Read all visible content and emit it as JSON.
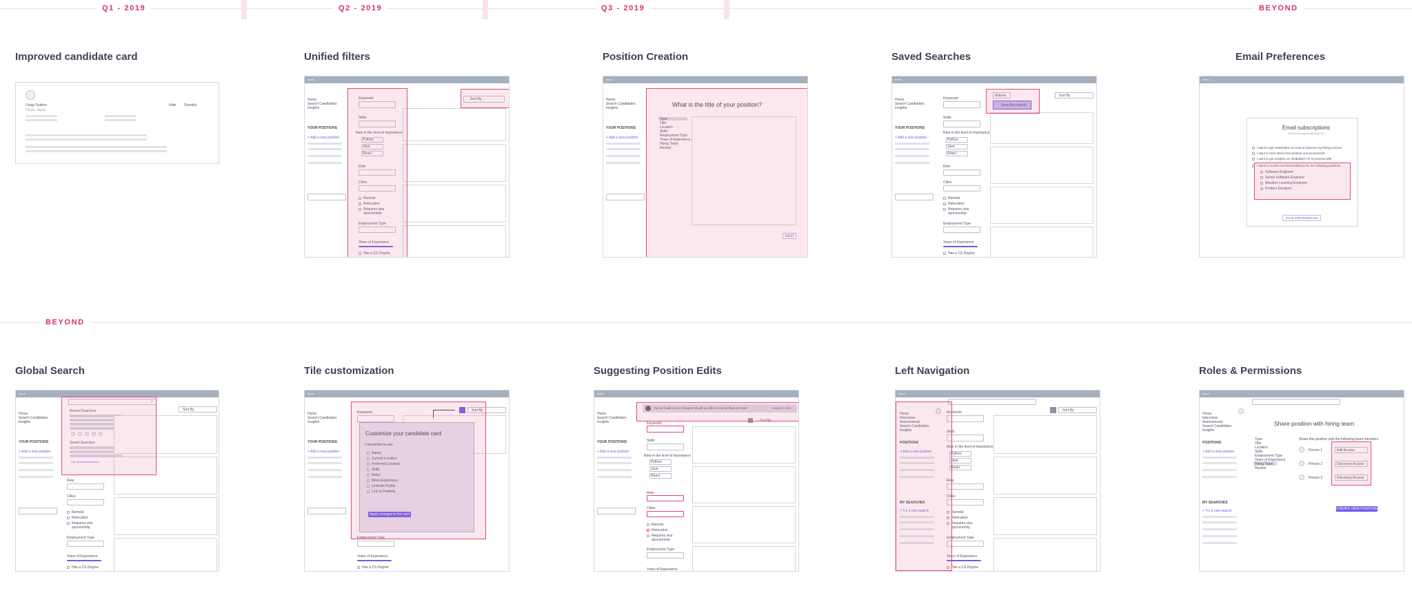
{
  "timeline": {
    "quarters": [
      {
        "label": "Q1 - 2019"
      },
      {
        "label": "Q2 - 2019"
      },
      {
        "label": "Q3 - 2019"
      },
      {
        "label": "BEYOND"
      }
    ],
    "row2_label": "BEYOND"
  },
  "accent": "#d8325a",
  "purple": "#6c5ce7",
  "highlight": "#e3477d",
  "nav": {
    "home": "Home",
    "search": "Search Candidates",
    "insights": "Insights",
    "interviews": "Interviews",
    "assessments": "Assessments",
    "positions": "YOUR POSITIONS",
    "positions_short": "POSITIONS",
    "add_position": "+ Add a new position",
    "my_searches": "MY SEARCHES",
    "try_search": "+ Try a new search"
  },
  "filters": {
    "keywords": "Keywords",
    "skills": "Skills",
    "importance": "Rate in the level of importance",
    "python": "Python",
    "java": "Java",
    "react": "React",
    "role": "Role",
    "cities": "Cities",
    "remote": "Remote",
    "relocation": "Relocation",
    "visa": "Requires visa sponsorship",
    "employment": "Employment Type",
    "years": "Years of Experience",
    "cs_degree": "Has a CS Degree",
    "sort_by": "Sort By"
  },
  "cards": {
    "candidate_card": {
      "title": "Improved candidate card",
      "name": "Usagi Tsukino",
      "location": "Tokyo, Japan",
      "hide": "Hide",
      "shortlist": "Shortlist"
    },
    "unified_filters": {
      "title": "Unified filters"
    },
    "position_creation": {
      "title": "Position Creation",
      "question": "What is the title of your position?",
      "steps": [
        "Type",
        "Title",
        "Location",
        "Skills",
        "Employment Type",
        "Years of Experience",
        "Hiring Team",
        "Review"
      ],
      "next": "NEXT"
    },
    "saved_searches": {
      "title": "Saved Searches",
      "actions": "Actions",
      "save_search": "Save this search"
    },
    "email_preferences": {
      "title": "Email Preferences",
      "heading": "Email subscriptions",
      "email": "sindhu.ad.sagelhu@email.net",
      "options": [
        "I want to get newsletters on how to improve my hiring process",
        "I want to hear about new product announcements",
        "I want to get insights on candidates I'm in process with",
        "I want to receive recommendations for the following positions"
      ],
      "positions": [
        "Software Engineer",
        "Senior Software Engineer",
        "Machine Learning Engineer",
        "Product Designer"
      ],
      "save": "SAVE PREFERENCES"
    },
    "global_search": {
      "title": "Global Search",
      "recent": "Recent Searches",
      "saved": "Saved Searches",
      "see_all": "See all saved searches"
    },
    "tile_customization": {
      "title": "Tile customization",
      "heading": "Customize your candidate card",
      "prompt": "I would like to see:",
      "options": [
        "Salary",
        "Current Location",
        "Preferred Location",
        "Skills",
        "Roles",
        "Work Experience",
        "LinkedIn Profile",
        "Link to Portfolio"
      ],
      "apply": "Apply changes to the card"
    },
    "position_edits": {
      "title": "Suggesting Position Edits",
      "banner": "You've made some changes! Would you like to submit them to Hiwi?",
      "suggest": "Suggest Edits"
    },
    "left_navigation": {
      "title": "Left Navigation"
    },
    "roles": {
      "title": "Roles & Permissions",
      "heading": "Share position with hiring team",
      "subheading": "Share this position with the following team members",
      "steps": [
        "Type",
        "Title",
        "Location",
        "Skills",
        "Employment Type",
        "Years of Experience",
        "Hiring Team",
        "Review"
      ],
      "people": [
        {
          "name": "Person 1",
          "access": "Edit Access"
        },
        {
          "name": "Person 2",
          "access": "Discovery Access"
        },
        {
          "name": "Person 3",
          "access": "Discovery Access"
        }
      ],
      "create": "CREATE NEW POSITION"
    }
  }
}
